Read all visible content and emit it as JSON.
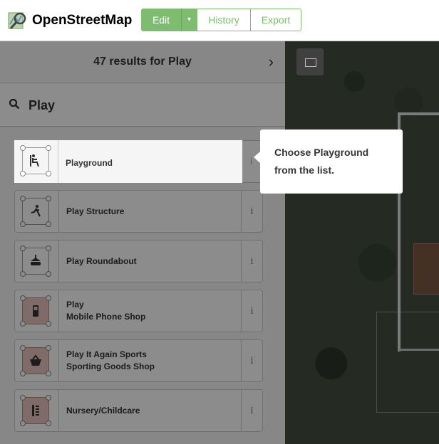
{
  "app": {
    "name": "OpenStreetMap",
    "toolbar": {
      "edit_label": "Edit",
      "caret": "▾",
      "history_label": "History",
      "export_label": "Export"
    }
  },
  "sidebar": {
    "results_title": "47 results for Play",
    "next_arrow": "›",
    "search_value": "Play",
    "presets": [
      {
        "lines": [
          "Playground"
        ],
        "info": "i",
        "icon": "playground-icon",
        "area": "plain"
      },
      {
        "lines": [
          "Play Structure"
        ],
        "info": "i",
        "icon": "play-structure-icon",
        "area": "plain"
      },
      {
        "lines": [
          "Play Roundabout"
        ],
        "info": "i",
        "icon": "roundabout-icon",
        "area": "plain"
      },
      {
        "lines": [
          "Play",
          "Mobile Phone Shop"
        ],
        "info": "i",
        "icon": "mobile-phone-icon",
        "area": "red"
      },
      {
        "lines": [
          "Play It Again Sports",
          "Sporting Goods Shop"
        ],
        "info": "i",
        "icon": "basket-icon",
        "area": "red"
      },
      {
        "lines": [
          "Nursery/Childcare"
        ],
        "info": "i",
        "icon": "childcare-icon",
        "area": "red"
      }
    ]
  },
  "tooltip": {
    "text_line1": "Choose Playground",
    "text_line2": "from the list."
  },
  "colors": {
    "brand_green": "#7ebc6f",
    "area_red": "#e8c5c0"
  }
}
